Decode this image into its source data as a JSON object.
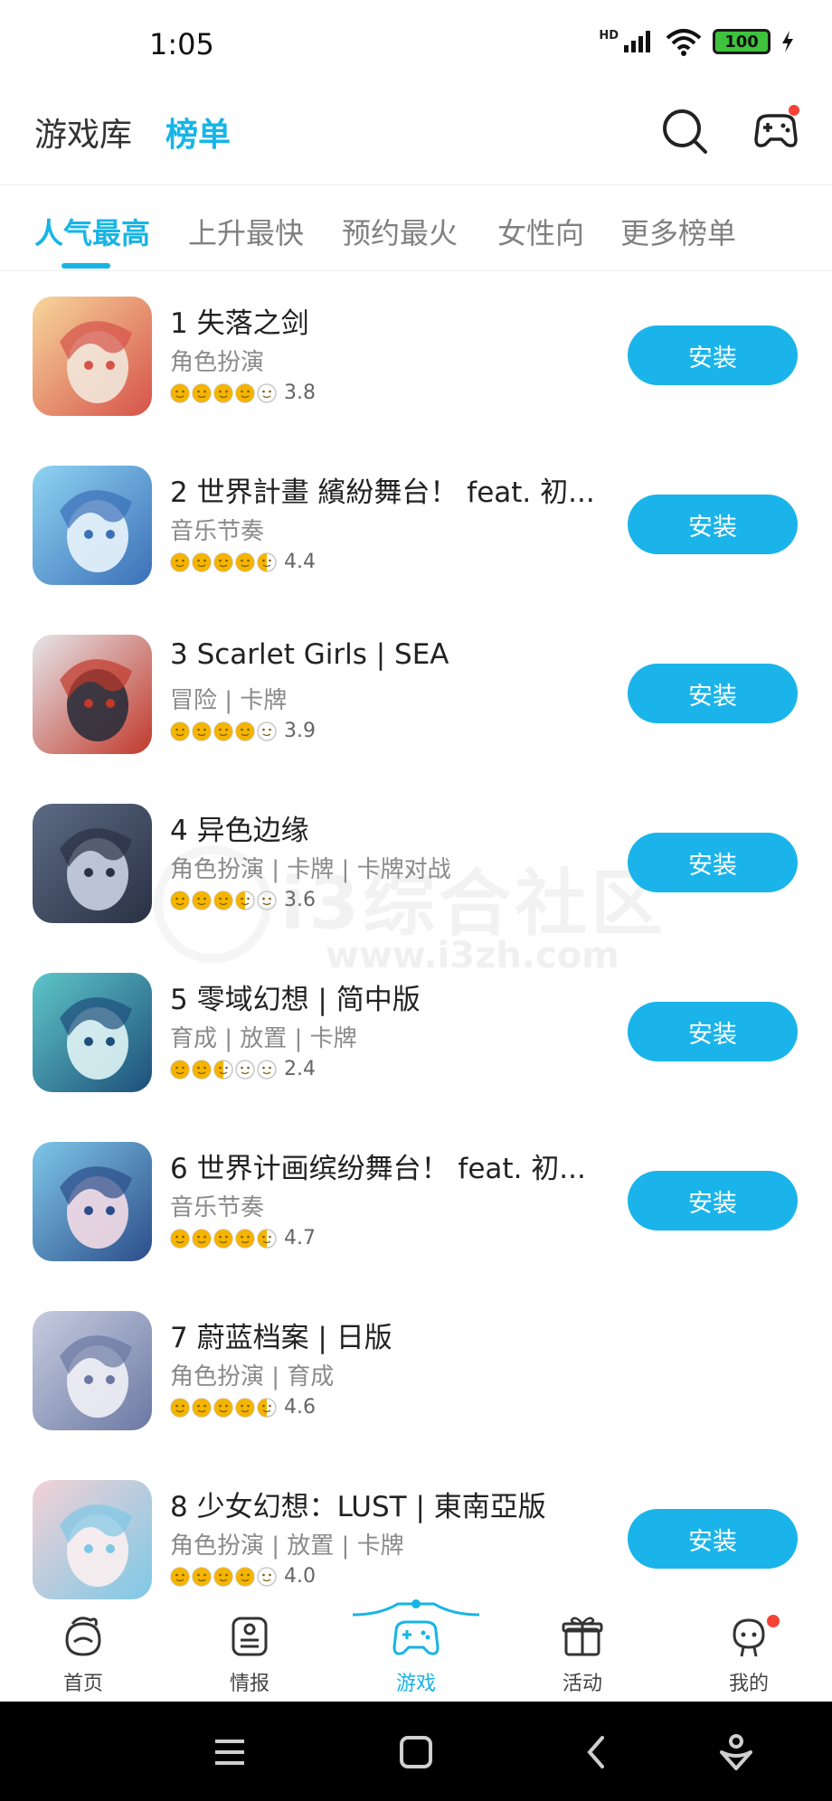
{
  "status_bar": {
    "time": "1:05",
    "hd": "HD",
    "battery": "100"
  },
  "header": {
    "tab_library": "游戏库",
    "tab_ranking": "榜单"
  },
  "category_tabs": [
    "人气最高",
    "上升最快",
    "预约最火",
    "女性向",
    "更多榜单"
  ],
  "games": [
    {
      "title": "1 失落之剑",
      "tags": "角色扮演",
      "rating": "3.8",
      "faces": 4,
      "install": "安装",
      "art": [
        "#f7d79b",
        "#d6524a",
        "#f2e7da"
      ]
    },
    {
      "title": "2 世界計畫 繽紛舞台！ feat. 初...",
      "tags": "音乐节奏",
      "rating": "4.4",
      "faces": 4.5,
      "install": "安装",
      "art": [
        "#8fd4f2",
        "#3b6fb8",
        "#e9f4fb"
      ]
    },
    {
      "title": "3 Scarlet Girls | SEA",
      "tags": "冒险 | 卡牌",
      "rating": "3.9",
      "faces": 4,
      "install": "安装",
      "art": [
        "#e6e6ea",
        "#c0392b",
        "#2b2d3a"
      ]
    },
    {
      "title": "4 异色边缘",
      "tags": "角色扮演 | 卡牌 | 卡牌对战",
      "rating": "3.6",
      "faces": 3.5,
      "install": "安装",
      "art": [
        "#5d6b85",
        "#2a3144",
        "#c9d2e2"
      ]
    },
    {
      "title": "5 零域幻想 | 简中版",
      "tags": "育成 | 放置 | 卡牌",
      "rating": "2.4",
      "faces": 2.5,
      "install": "安装",
      "art": [
        "#5fc6c9",
        "#1d4f7a",
        "#e0f4f5"
      ]
    },
    {
      "title": "6 世界计画缤纷舞台！ feat. 初...",
      "tags": "音乐节奏",
      "rating": "4.7",
      "faces": 4.5,
      "install": "安装",
      "art": [
        "#7ec7e8",
        "#2c4d8a",
        "#f4dbe6"
      ]
    },
    {
      "title": "7 蔚蓝档案 | 日版",
      "tags": "角色扮演 | 育成",
      "rating": "4.6",
      "faces": 4.5,
      "install": "",
      "art": [
        "#c7cde0",
        "#6b78a3",
        "#f1f1f6"
      ]
    },
    {
      "title": "8 少女幻想：LUST | 東南亞版",
      "tags": "角色扮演 | 放置 | 卡牌",
      "rating": "4.0",
      "faces": 4,
      "install": "安装",
      "art": [
        "#f3d1d6",
        "#7dc8e6",
        "#fbeff1"
      ]
    }
  ],
  "watermark": {
    "text": "i3综合社区",
    "url": "www.i3zh.com"
  },
  "bottom_nav": [
    "首页",
    "情报",
    "游戏",
    "活动",
    "我的"
  ],
  "colors": {
    "accent": "#16b5e6",
    "install_bg": "#1ab4ea",
    "face_color": "#f5b400",
    "badge_red": "#f44336"
  }
}
